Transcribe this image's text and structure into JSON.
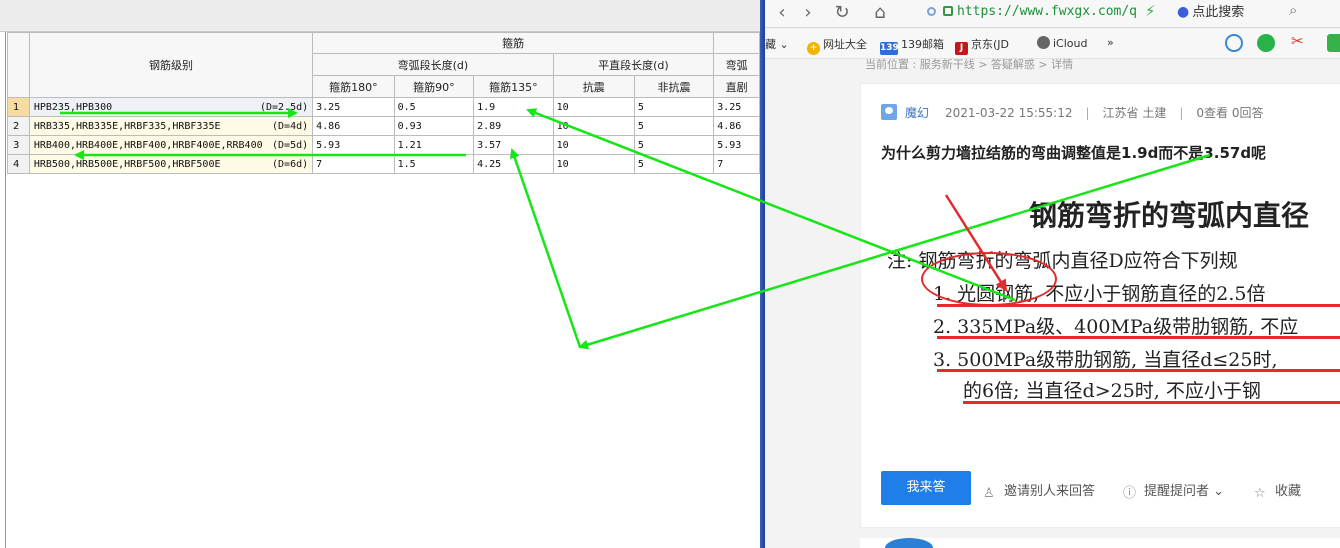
{
  "sheet": {
    "header": {
      "grade": "钢筋级别",
      "group": "箍筋",
      "arc_length": "弯弧段长度(d)",
      "straight_length": "平直段长度(d)",
      "arc_inner_partial": "弯弧",
      "col_180": "箍筋180°",
      "col_90": "箍筋90°",
      "col_135": "箍筋135°",
      "col_seismic": "抗震",
      "col_nonseismic": "非抗震",
      "col_straight_partial": "直剧"
    },
    "rows": [
      {
        "num": "1",
        "grade": "HPB235,HPB300",
        "d": "(D=2.5d)",
        "c180": "3.25",
        "c90": "0.5",
        "c135": "1.9",
        "seismic": "10",
        "nonseismic": "5",
        "inner": "3.25"
      },
      {
        "num": "2",
        "grade": "HRB335,HRB335E,HRBF335,HRBF335E",
        "d": "(D=4d)",
        "c180": "4.86",
        "c90": "0.93",
        "c135": "2.89",
        "seismic": "10",
        "nonseismic": "5",
        "inner": "4.86"
      },
      {
        "num": "3",
        "grade": "HRB400,HRB400E,HRBF400,HRBF400E,RRB400",
        "d": "(D=5d)",
        "c180": "5.93",
        "c90": "1.21",
        "c135": "3.57",
        "seismic": "10",
        "nonseismic": "5",
        "inner": "5.93"
      },
      {
        "num": "4",
        "grade": "HRB500,HRB500E,HRBF500,HRBF500E",
        "d": "(D=6d)",
        "c180": "7",
        "c90": "1.5",
        "c135": "4.25",
        "seismic": "10",
        "nonseismic": "5",
        "inner": "7"
      }
    ]
  },
  "browser": {
    "url": "https://www.fwxgx.com/q",
    "search_engine": "点此搜索",
    "bookmarks": {
      "fav": "藏",
      "site_nav": "网址大全",
      "mail": "139邮箱",
      "jd": "京东(JD",
      "icloud": "iCloud",
      "more": "»"
    },
    "breadcrumb": "当前位置 : 服务新干线 > 答疑解惑 > 详情",
    "question": {
      "author": "魔幻",
      "datetime": "2021-03-22 15:55:12",
      "region": "江苏省 土建",
      "stats": "0查看 0回答",
      "title": "为什么剪力墙拉结筋的弯曲调整值是1.9d而不是3.57d呢"
    },
    "figure": {
      "title": "钢筋弯折的弯弧内直径",
      "line1": "注: 钢筋弯折的弯弧内直径D应符合下列规",
      "line2": "1. 光圆钢筋, 不应小于钢筋直径的2.5倍",
      "line3": "2. 335MPa级、400MPa级带肋钢筋, 不应",
      "line4": "3. 500MPa级带肋钢筋, 当直径d≤25时,",
      "line5": "的6倍; 当直径d>25时, 不应小于钢"
    },
    "actions": {
      "answer": "我来答",
      "invite": "邀请别人来回答",
      "remind": "提醒提问者",
      "favorite": "收藏"
    }
  },
  "colors": {
    "annotation_arrow": "#16e516",
    "annotation_red": "#e42b2b",
    "answer_button": "#1f7fe8",
    "divider": "#2b4fae",
    "header_gold": "#f7c965"
  }
}
